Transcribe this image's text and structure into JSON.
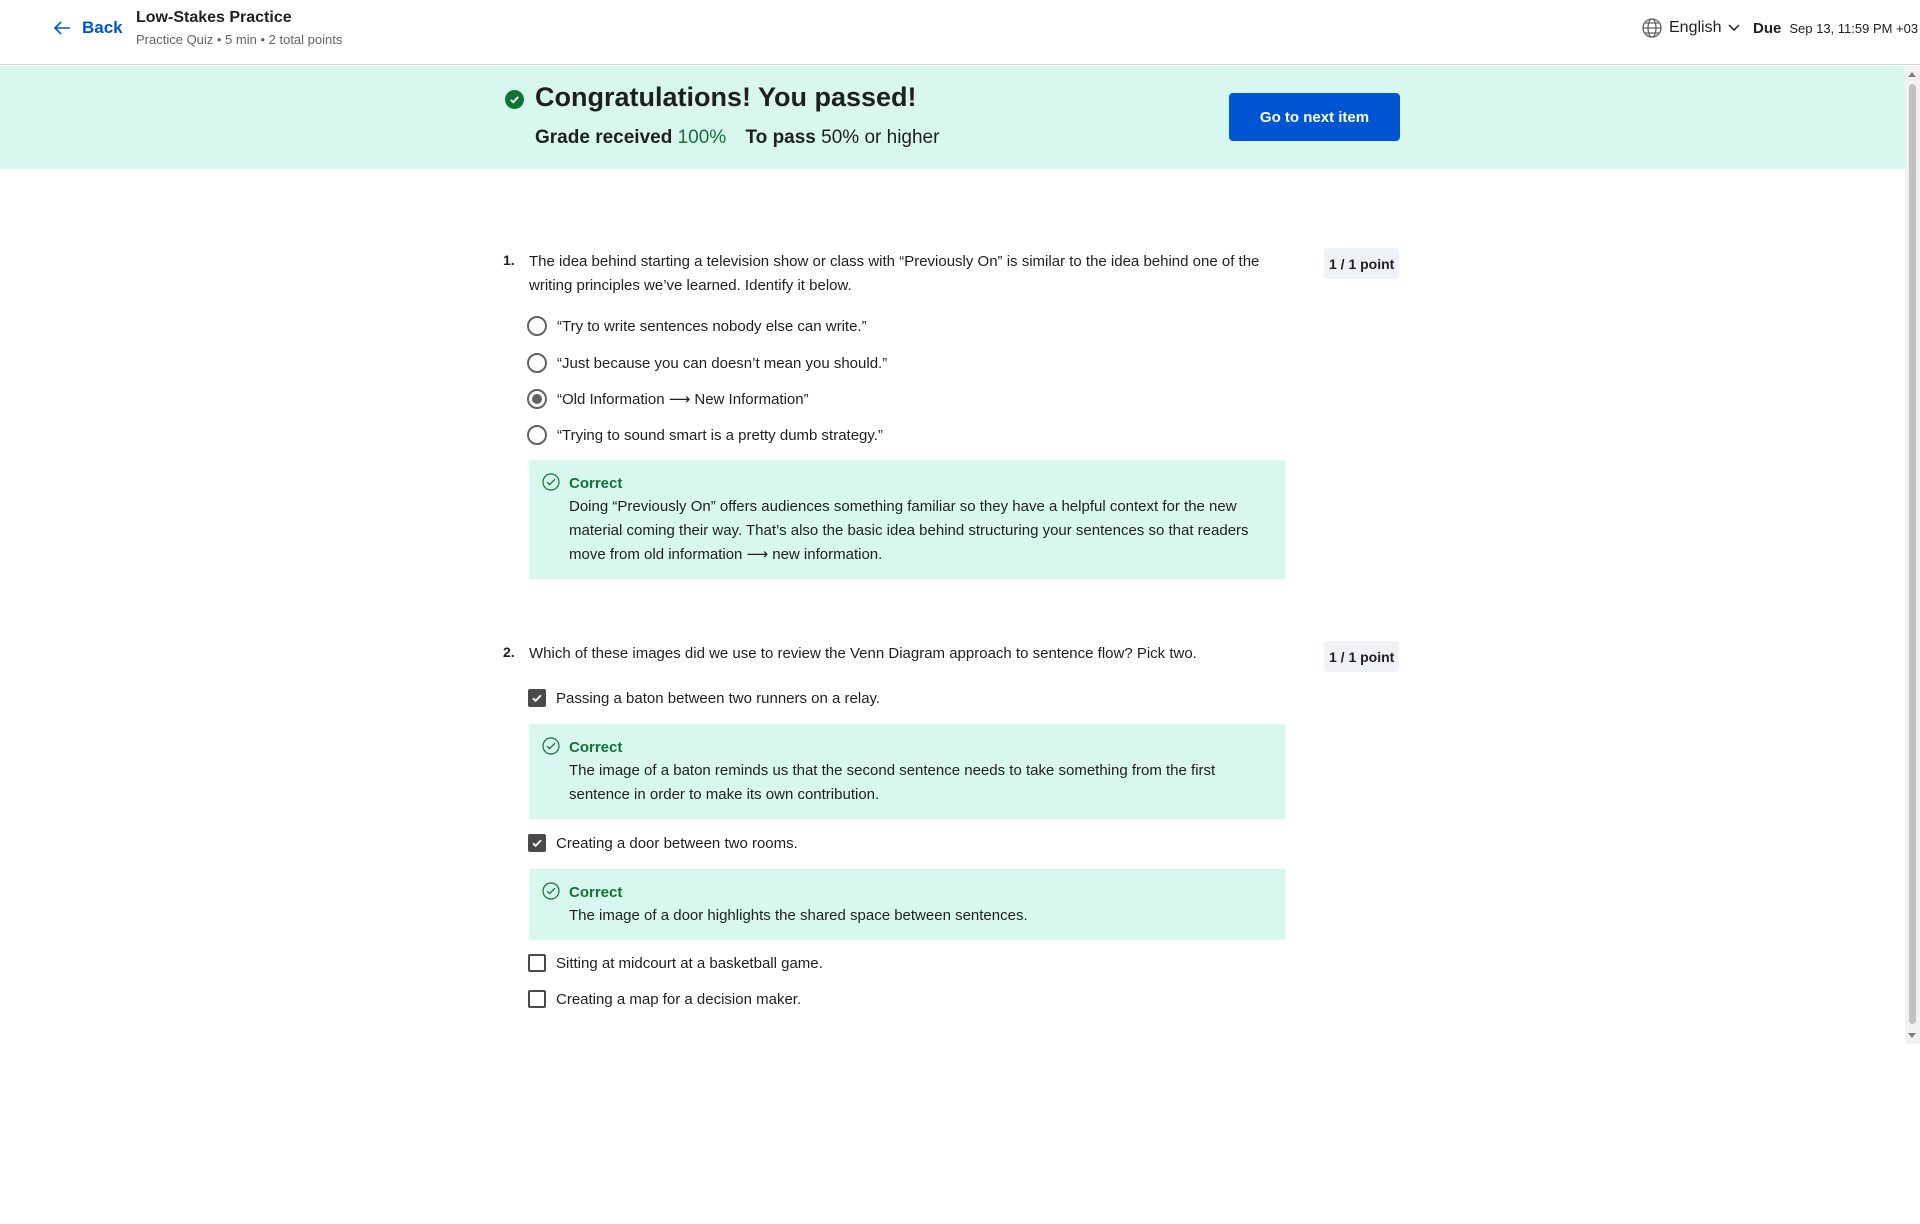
{
  "header": {
    "back_label": "Back",
    "title": "Low-Stakes Practice",
    "subtitle": "Practice Quiz • 5 min • 2 total points",
    "language": "English",
    "due_label": "Due",
    "due_date": "Sep 13, 11:59 PM +03"
  },
  "banner": {
    "title": "Congratulations! You passed!",
    "grade_label": "Grade received",
    "grade_value": "100%",
    "pass_label": "To pass",
    "pass_value": "50% or higher",
    "next_button": "Go to next item"
  },
  "questions": [
    {
      "number": "1.",
      "text": "The idea behind starting a television show or class with “Previously On” is similar to the idea behind one of the writing principles we’ve learned. Identify it below.",
      "points": "1 / 1 point",
      "type": "radio",
      "options": [
        {
          "label": "“Try to write sentences nobody else can write.”",
          "selected": false
        },
        {
          "label": "“Just because you can doesn’t mean you should.”",
          "selected": false
        },
        {
          "label": "“Old Information ⟶ New Information”",
          "selected": true
        },
        {
          "label": "“Trying to sound smart is a pretty dumb strategy.”",
          "selected": false
        }
      ],
      "feedback": {
        "title": "Correct",
        "text": "Doing “Previously On” offers audiences something familiar so they have a helpful context for the new material coming their way. That’s also the basic idea behind structuring your sentences so that readers move from old information ⟶ new information."
      }
    },
    {
      "number": "2.",
      "text": "Which of these images did we use to review the Venn Diagram approach to sentence flow?  Pick two.",
      "points": "1 / 1 point",
      "type": "checkbox",
      "options": [
        {
          "label": "Passing a baton between two runners on a relay.",
          "selected": true,
          "feedback_title": "Correct",
          "feedback_text": "The image of a baton reminds us that the second sentence needs to take something from the first sentence in order to make its own contribution."
        },
        {
          "label": "Creating a door between two rooms.",
          "selected": true,
          "feedback_title": "Correct",
          "feedback_text": "The image of a door highlights the shared space between sentences."
        },
        {
          "label": "Sitting at midcourt at a basketball game.",
          "selected": false
        },
        {
          "label": "Creating a map for a decision maker.",
          "selected": false
        }
      ]
    }
  ],
  "colors": {
    "brand_blue": "#0056d2",
    "success_green": "#137333",
    "banner_bg": "#d7f7ef"
  }
}
